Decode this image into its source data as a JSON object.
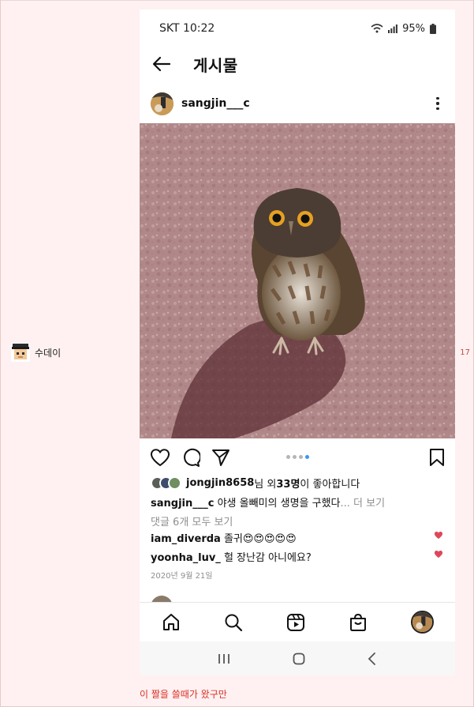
{
  "author": {
    "name": "수데이"
  },
  "count": "17",
  "comment_line": "이 짤을 쓸때가 왔구만",
  "phone": {
    "status": {
      "carrier_time": "SKT 10:22",
      "battery": "95%"
    },
    "topbar": {
      "title": "게시물"
    },
    "post": {
      "username": "sangjin___c",
      "likes": {
        "user": "jongjin8658",
        "suffix1": "님 외 ",
        "count": "33명",
        "suffix2": "이 좋아합니다"
      },
      "caption": {
        "user": "sangjin___c",
        "text": " 야생 올빼미의 생명을 구했다",
        "more": "... 더 보기"
      },
      "view_all": "댓글 6개 모두 보기",
      "comments": [
        {
          "user": "iam_diverda",
          "text": " 졸귀😍😍😍😍😍"
        },
        {
          "user": "yoonha_luv_",
          "text": " 헐 장난감 아니에요?"
        }
      ],
      "date": "2020년 9월 21일"
    }
  },
  "colors": {
    "accent_blue": "#3897f0",
    "heart_red": "#e0465a",
    "comment_red": "#d93025"
  }
}
